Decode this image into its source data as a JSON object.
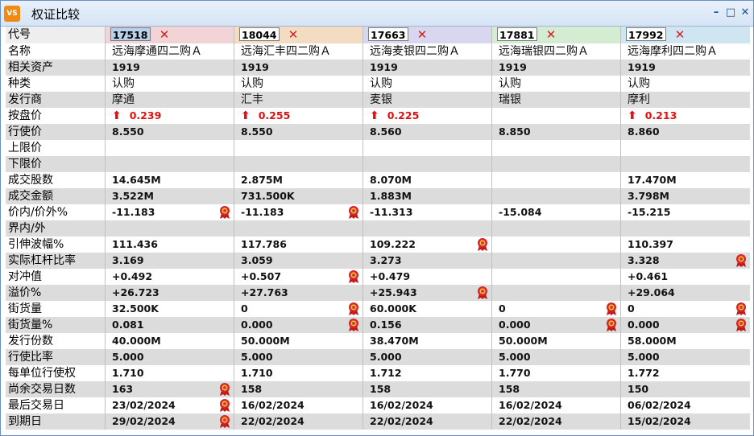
{
  "window": {
    "title": "权证比较",
    "app_icon": "VS"
  },
  "codes": [
    {
      "code": "17518",
      "selected": true
    },
    {
      "code": "18044",
      "selected": false
    },
    {
      "code": "17663",
      "selected": false
    },
    {
      "code": "17881",
      "selected": false
    },
    {
      "code": "17992",
      "selected": false
    }
  ],
  "header_label": "代号",
  "header_colors": [
    "#f2d4d6",
    "#f4dcc2",
    "#d9d6ef",
    "#d4ecd1",
    "#cfe6f2"
  ],
  "rows": [
    {
      "label": "名称",
      "type": "txt",
      "values": [
        "远海摩通四二购Ａ",
        "远海汇丰四二购Ａ",
        "远海麦银四二购Ａ",
        "远海瑞银四二购Ａ",
        "远海摩利四二购Ａ"
      ]
    },
    {
      "label": "相关资产",
      "values": [
        "1919",
        "1919",
        "1919",
        "1919",
        "1919"
      ]
    },
    {
      "label": "种类",
      "type": "txt",
      "values": [
        "认购",
        "认购",
        "认购",
        "认购",
        "认购"
      ]
    },
    {
      "label": "发行商",
      "type": "txt",
      "values": [
        "摩通",
        "汇丰",
        "麦银",
        "瑞银",
        "摩利"
      ]
    },
    {
      "label": "按盘价",
      "type": "price",
      "values": [
        "0.239",
        "0.255",
        "0.225",
        "",
        "0.213"
      ]
    },
    {
      "label": "行使价",
      "values": [
        "8.550",
        "8.550",
        "8.560",
        "8.850",
        "8.860"
      ]
    },
    {
      "label": "上限价",
      "values": [
        "",
        "",
        "",
        "",
        ""
      ]
    },
    {
      "label": "下限价",
      "values": [
        "",
        "",
        "",
        "",
        ""
      ]
    },
    {
      "label": "成交股数",
      "values": [
        "14.645M",
        "2.875M",
        "8.070M",
        "",
        "17.470M"
      ]
    },
    {
      "label": "成交金额",
      "values": [
        "3.522M",
        "731.500K",
        "1.883M",
        "",
        "3.798M"
      ]
    },
    {
      "label": "价内/价外%",
      "values": [
        "-11.183",
        "-11.183",
        "-11.313",
        "-15.084",
        "-15.215"
      ],
      "medals": [
        true,
        true,
        false,
        false,
        false
      ]
    },
    {
      "label": "界内/外",
      "values": [
        "",
        "",
        "",
        "",
        ""
      ]
    },
    {
      "label": "引伸波幅%",
      "values": [
        "111.436",
        "117.786",
        "109.222",
        "",
        "110.397"
      ],
      "medals": [
        false,
        false,
        true,
        false,
        false
      ]
    },
    {
      "label": "实际杠杆比率",
      "values": [
        "3.169",
        "3.059",
        "3.273",
        "",
        "3.328"
      ],
      "medals": [
        false,
        false,
        false,
        false,
        true
      ]
    },
    {
      "label": "对冲值",
      "values": [
        "+0.492",
        "+0.507",
        "+0.479",
        "",
        "+0.461"
      ],
      "medals": [
        false,
        true,
        false,
        false,
        false
      ]
    },
    {
      "label": "溢价%",
      "values": [
        "+26.723",
        "+27.763",
        "+25.943",
        "",
        "+29.064"
      ],
      "medals": [
        false,
        false,
        true,
        false,
        false
      ]
    },
    {
      "label": "街货量",
      "values": [
        "32.500K",
        "0",
        "60.000K",
        "0",
        "0"
      ],
      "medals": [
        false,
        true,
        false,
        true,
        true
      ]
    },
    {
      "label": "街货量%",
      "values": [
        "0.081",
        "0.000",
        "0.156",
        "0.000",
        "0.000"
      ],
      "medals": [
        false,
        true,
        false,
        true,
        true
      ]
    },
    {
      "label": "发行份数",
      "values": [
        "40.000M",
        "50.000M",
        "38.470M",
        "50.000M",
        "58.000M"
      ]
    },
    {
      "label": "行使比率",
      "values": [
        "5.000",
        "5.000",
        "5.000",
        "5.000",
        "5.000"
      ]
    },
    {
      "label": "每单位行使权",
      "values": [
        "1.710",
        "1.710",
        "1.712",
        "1.770",
        "1.772"
      ]
    },
    {
      "label": "尚余交易日数",
      "values": [
        "163",
        "158",
        "158",
        "158",
        "150"
      ],
      "medals": [
        true,
        false,
        false,
        false,
        false
      ]
    },
    {
      "label": "最后交易日",
      "values": [
        "23/02/2024",
        "16/02/2024",
        "16/02/2024",
        "16/02/2024",
        "06/02/2024"
      ],
      "medals": [
        true,
        false,
        false,
        false,
        false
      ]
    },
    {
      "label": "到期日",
      "values": [
        "29/02/2024",
        "22/02/2024",
        "22/02/2024",
        "22/02/2024",
        "15/02/2024"
      ],
      "medals": [
        true,
        false,
        false,
        false,
        false
      ]
    }
  ],
  "icons": {
    "up": "up-arrow-icon",
    "medal": "medal-icon",
    "remove": "close-icon"
  },
  "colors": {
    "up": "#e01010",
    "alt_row": "#dcdcdc",
    "title_bar": "#d6e4f5"
  }
}
